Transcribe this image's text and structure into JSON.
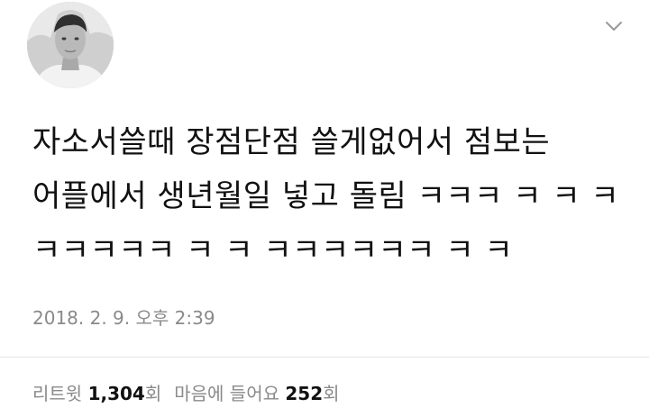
{
  "tweet": {
    "text": "자소서쓸때 장점단점 쓸게없어서 점보는 어플에서 생년월일 넣고 돌림 ㅋㅋㅋ ㅋ ㅋ ㅋ ㅋㅋㅋㅋㅋ ㅋ ㅋ ㅋㅋㅋㅋㅋㅋ ㅋ ㅋ",
    "timestamp": "2018. 2. 9. 오후 2:39"
  },
  "stats": {
    "retweets_label": "리트윗",
    "retweets_count": "1,304",
    "retweets_suffix": "회",
    "likes_label": "마음에 들어요",
    "likes_count": "252",
    "likes_suffix": "회"
  },
  "icons": {
    "avatar": "profile-photo-grayscale",
    "menu": "chevron-down-icon"
  }
}
